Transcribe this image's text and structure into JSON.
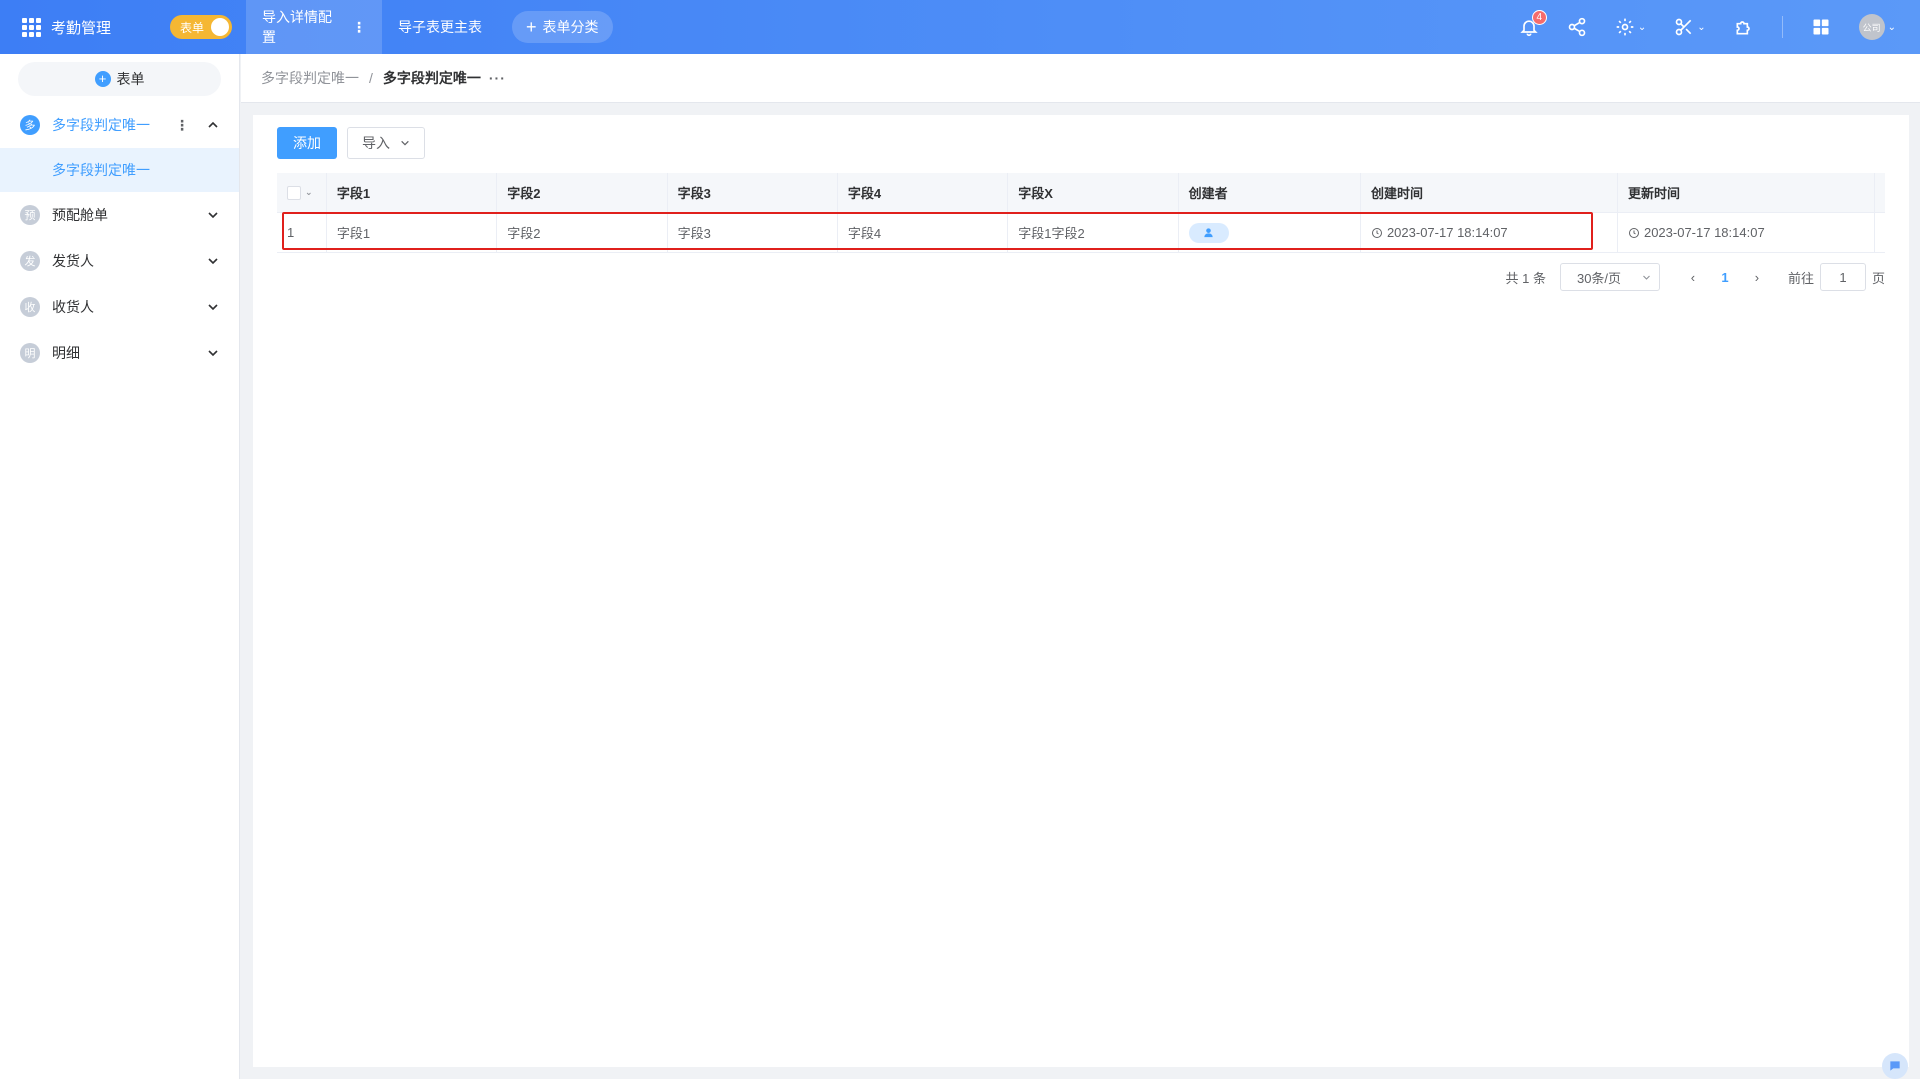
{
  "app": {
    "title": "考勤管理",
    "mode_toggle_label": "表单"
  },
  "top_tabs": [
    {
      "label": "导入详情配置"
    },
    {
      "label": "导子表更主表"
    }
  ],
  "add_category_label": "表单分类",
  "notifications": {
    "count": "4"
  },
  "avatar_text": "公司",
  "sidebar": {
    "new_form_label": "表单",
    "groups": [
      {
        "avatar": "多",
        "label": "多字段判定唯一",
        "sub_items": [
          "多字段判定唯一"
        ]
      },
      {
        "avatar": "预",
        "label": "预配舱单"
      },
      {
        "avatar": "发",
        "label": "发货人"
      },
      {
        "avatar": "收",
        "label": "收货人"
      },
      {
        "avatar": "明",
        "label": "明细"
      }
    ]
  },
  "breadcrumb": {
    "prev": "多字段判定唯一",
    "separator": "/",
    "current": "多字段判定唯一",
    "more": "···"
  },
  "toolbar": {
    "add_label": "添加",
    "import_label": "导入"
  },
  "table": {
    "headers": [
      "字段1",
      "字段2",
      "字段3",
      "字段4",
      "字段X",
      "创建者",
      "创建时间",
      "更新时间"
    ],
    "rows": [
      {
        "index": "1",
        "cells": [
          "字段1",
          "字段2",
          "字段3",
          "字段4",
          "字段1字段2"
        ],
        "created_at": "2023-07-17 18:14:07",
        "updated_at": "2023-07-17 18:14:07"
      }
    ]
  },
  "pagination": {
    "total": "共 1 条",
    "page_size": "30条/页",
    "current_page": "1",
    "goto_label": "前往",
    "goto_value": "1",
    "page_suffix": "页"
  },
  "colors": {
    "primary": "#409eff",
    "topbar": "#4f8ff7",
    "toggle": "#f5b733",
    "highlight": "#e0201c"
  }
}
